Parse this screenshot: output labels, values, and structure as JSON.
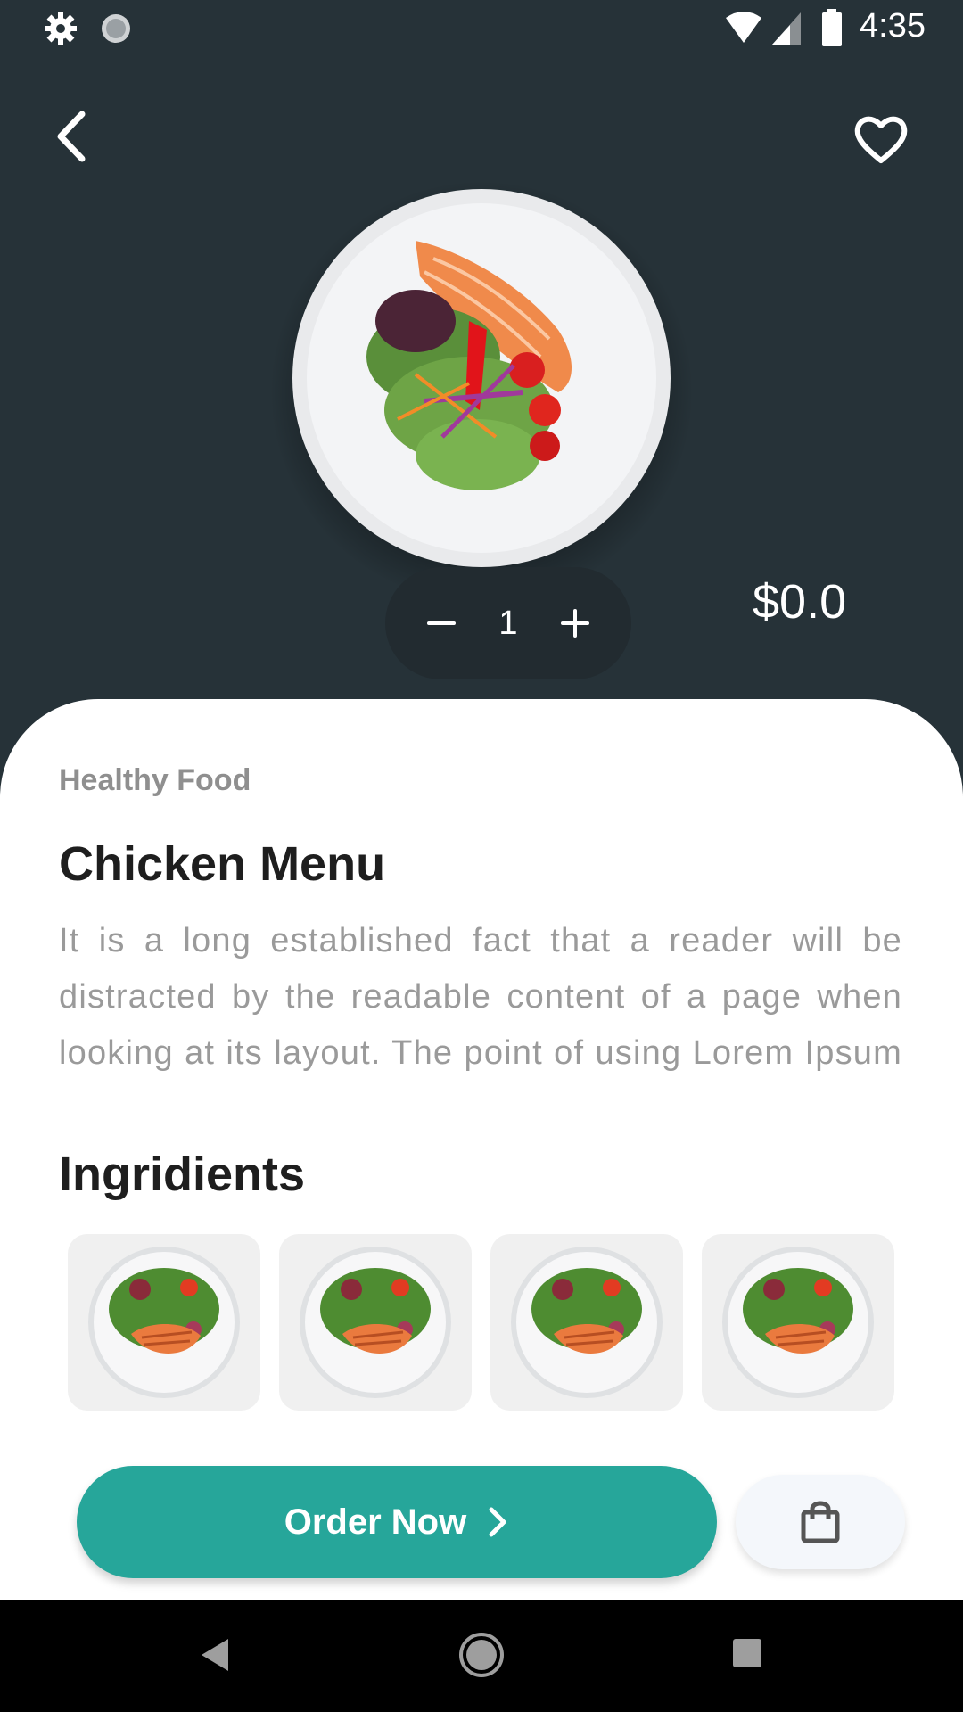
{
  "status_bar": {
    "time": "4:35"
  },
  "product": {
    "price": "$0.0",
    "quantity": "1",
    "category": "Healthy Food",
    "title": "Chicken Menu",
    "description": "It is a long established fact that a reader will be distracted by the readable content of a page when looking at its layout. The point of using Lorem Ipsum is that it has a more-or-less normal distribution of letters."
  },
  "ingredients": {
    "heading": "Ingridients",
    "items": [
      "salad-plate",
      "salad-plate",
      "salad-plate",
      "salad-plate"
    ]
  },
  "actions": {
    "order_label": "Order Now"
  },
  "icons": {
    "back": "chevron-left-icon",
    "favorite": "heart-outline-icon",
    "minus": "minus-icon",
    "plus": "plus-icon",
    "order_arrow": "chevron-right-icon",
    "bag": "shopping-bag-icon"
  },
  "colors": {
    "background": "#263238",
    "accent": "#26a69a",
    "stepper": "#222b30"
  }
}
